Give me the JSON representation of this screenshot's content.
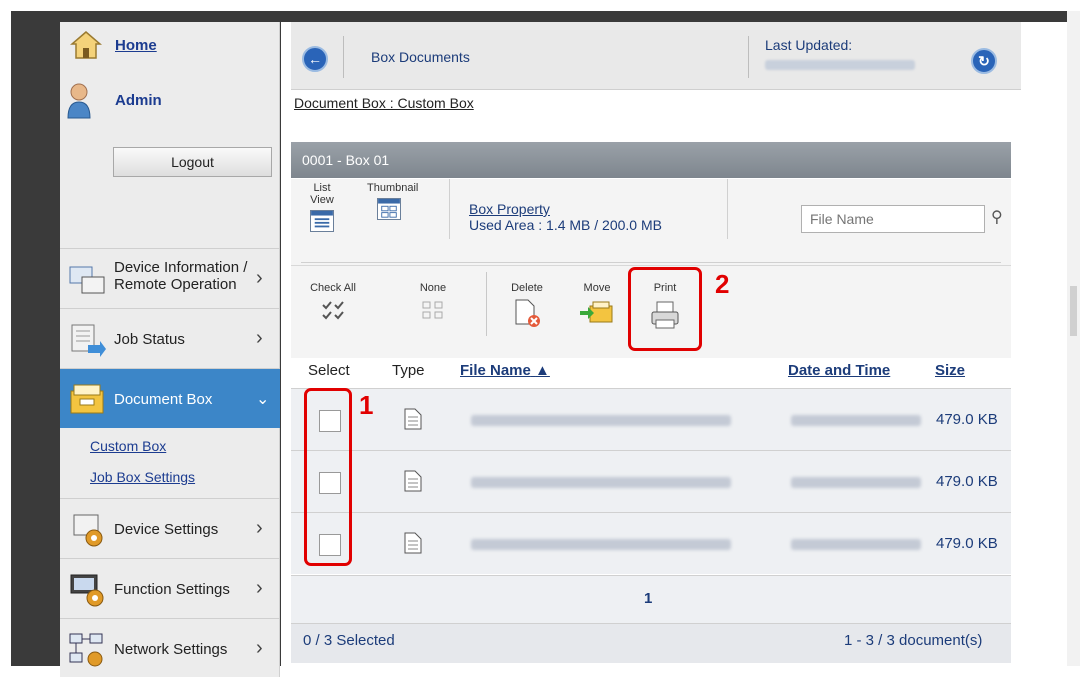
{
  "sidebar": {
    "home_label": "Home",
    "user_label": "Admin",
    "logout_label": "Logout",
    "nav": [
      {
        "line1": "Device Information /",
        "line2": "Remote Operation"
      },
      {
        "label": "Job Status"
      },
      {
        "label": "Document Box"
      },
      {
        "label": "Device Settings"
      },
      {
        "label": "Function Settings"
      },
      {
        "label": "Network Settings"
      }
    ],
    "sub_links": [
      "Custom Box",
      "Job Box Settings"
    ]
  },
  "topbar": {
    "title": "Box Documents",
    "last_updated_label": "Last Updated:"
  },
  "breadcrumb": "Document Box : Custom Box",
  "box_header": "0001 - Box 01",
  "view_tools": {
    "list_view": "List View",
    "thumbnail": "Thumbnail"
  },
  "box_property": {
    "title": "Box Property",
    "used_area": "Used Area : 1.4 MB / 200.0 MB"
  },
  "search": {
    "placeholder": "File Name"
  },
  "actions": {
    "check_all": "Check All",
    "none": "None",
    "delete": "Delete",
    "move": "Move",
    "print": "Print"
  },
  "callouts": {
    "one": "1",
    "two": "2"
  },
  "table": {
    "headers": {
      "select": "Select",
      "type": "Type",
      "file_name": "File Name",
      "date_time": "Date and Time",
      "size": "Size"
    },
    "rows": [
      {
        "size": "479.0 KB"
      },
      {
        "size": "479.0 KB"
      },
      {
        "size": "479.0 KB"
      }
    ]
  },
  "pager": {
    "page": "1"
  },
  "footer": {
    "selected": "0 / 3 Selected",
    "count": "1 - 3 / 3 document(s)"
  },
  "colors": {
    "accent": "#3c86c8",
    "link": "#1c3c7a",
    "callout": "#e10000"
  }
}
